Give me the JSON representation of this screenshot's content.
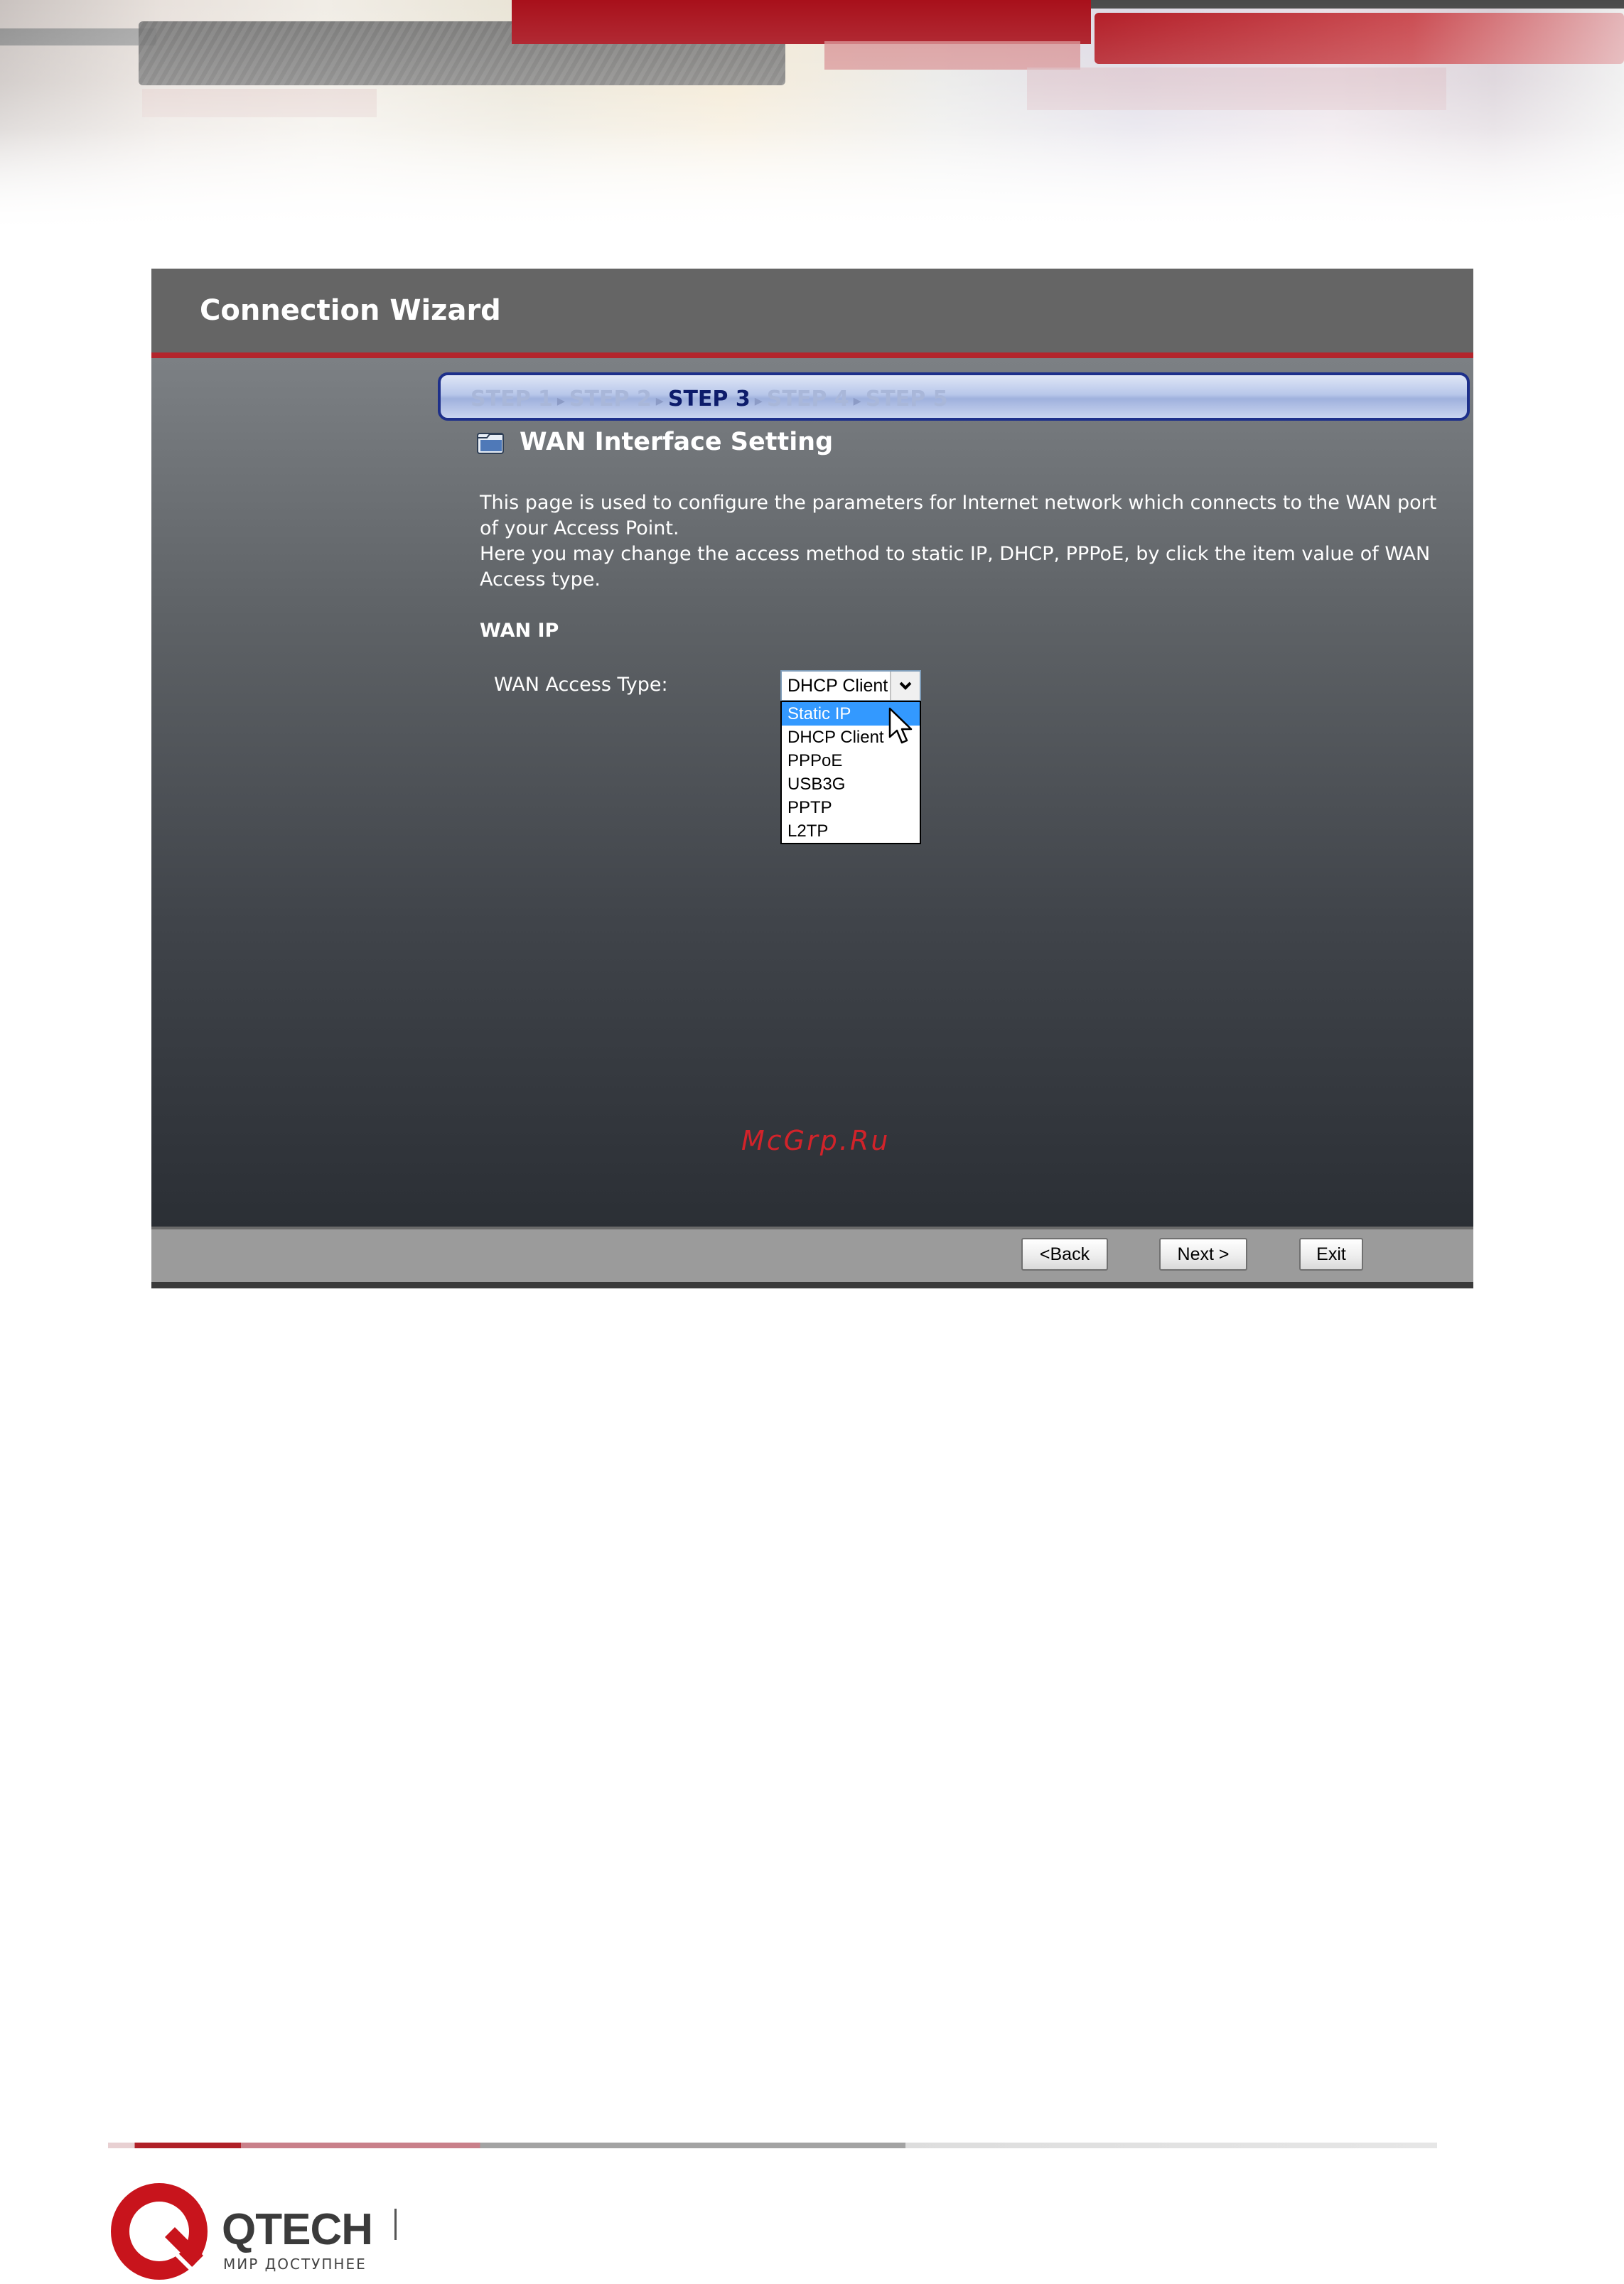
{
  "wizard": {
    "title": "Connection Wizard",
    "steps": [
      "STEP 1",
      "STEP 2",
      "STEP 3",
      "STEP 4",
      "STEP 5"
    ],
    "active_step": "STEP 3",
    "section_title": "WAN Interface Setting",
    "description_1": "This page is used to configure the parameters for Internet network which connects to the WAN port of your Access Point.",
    "description_2": "Here you may change the access method to static IP, DHCP, PPPoE, by click the item value of WAN Access type.",
    "wan_ip_heading": "WAN IP",
    "wan_access_label": "WAN Access Type:",
    "wan_access_value": "DHCP Client",
    "wan_access_options": [
      "Static IP",
      "DHCP Client",
      "PPPoE",
      "USB3G",
      "PPTP",
      "L2TP"
    ],
    "highlighted_option": "Static IP",
    "buttons": {
      "back": "<Back",
      "next": "Next >",
      "exit": "Exit"
    }
  },
  "watermark": "McGrp.Ru",
  "footer": {
    "brand": "QTECH",
    "tagline": "МИР ДОСТУПНЕЕ"
  },
  "colors": {
    "accent_red": "#b3252c",
    "step_border": "#1d2f8a",
    "selection_blue": "#3399ff"
  }
}
